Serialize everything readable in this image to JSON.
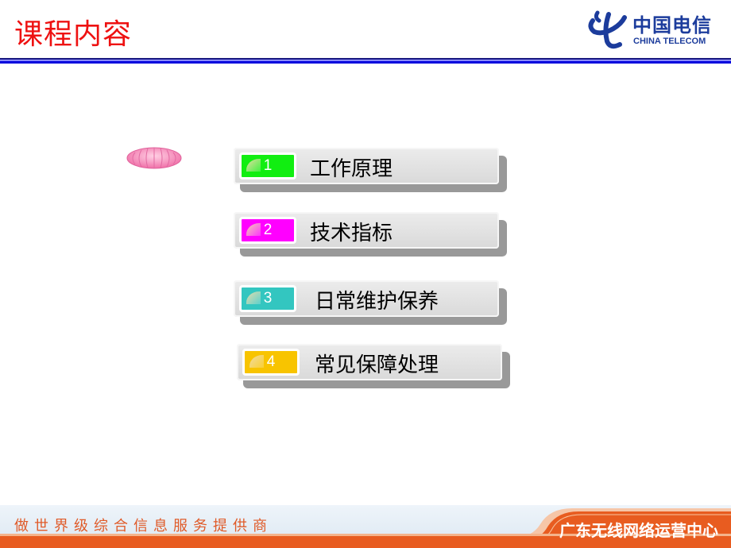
{
  "header": {
    "title": "课程内容",
    "logo": {
      "icon": "china-telecom-logo-icon",
      "name_cn": "中国电信",
      "name_en": "CHINA TELECOM"
    },
    "rule_color": "#0000dd"
  },
  "decoration": {
    "icon": "pink-shell-icon"
  },
  "menu": {
    "items": [
      {
        "number": "1",
        "label": "工作原理",
        "color": "#11ee11"
      },
      {
        "number": "2",
        "label": "技术指标",
        "color": "#ff00ff"
      },
      {
        "number": "3",
        "label": "日常维护保养",
        "color": "#33c6c0"
      },
      {
        "number": "4",
        "label": "常见保障处理",
        "color": "#f8c400"
      }
    ]
  },
  "footer": {
    "slogan": "做世界级综合信息服务提供商",
    "center": "广东无线网络运营中心",
    "accent": "#e85c20"
  }
}
